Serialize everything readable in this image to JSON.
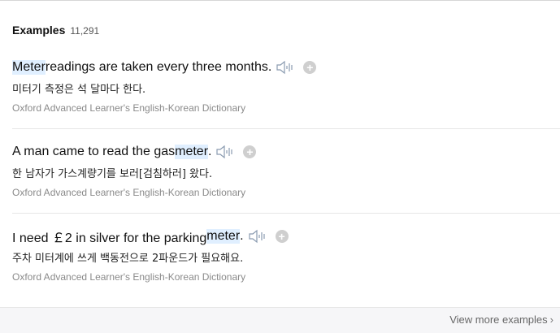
{
  "examples": {
    "title": "Examples",
    "count": "11,291",
    "items": [
      {
        "pre": "",
        "highlight": "Meter",
        "post": " readings are taken every three months.",
        "translation": "미터기 측정은 석 달마다 한다.",
        "source": "Oxford Advanced Learner's English-Korean Dictionary"
      },
      {
        "pre": "A man came to read the gas ",
        "highlight": "meter",
        "post": ".",
        "translation": "한 남자가 가스계량기를 보러[검침하러] 왔다.",
        "source": "Oxford Advanced Learner's English-Korean Dictionary"
      },
      {
        "pre": "I need ￡2 in silver for the parking ",
        "highlight": "meter",
        "post": ".",
        "translation": "주차 미터계에 쓰게 백동전으로 2파운드가 필요해요.",
        "source": "Oxford Advanced Learner's English-Korean Dictionary"
      }
    ],
    "speaker_icon": "speaker-icon",
    "add_icon": "plus-icon",
    "highlight_color": "#e0efff",
    "view_more_label": "View more examples"
  }
}
